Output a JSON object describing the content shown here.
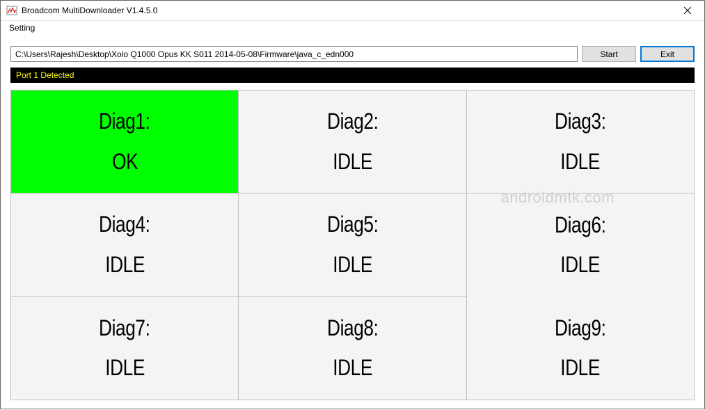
{
  "window": {
    "title": "Broadcom MultiDownloader V1.4.5.0"
  },
  "menu": {
    "setting": "Setting"
  },
  "toolbar": {
    "path_value": "C:\\Users\\Rajesh\\Desktop\\Xolo Q1000 Opus KK S011 2014-05-08\\Firmware\\java_c_edn000",
    "start_label": "Start",
    "exit_label": "Exit"
  },
  "status": {
    "text": "Port 1 Detected"
  },
  "diag": {
    "cells": [
      {
        "label": "Diag1:",
        "status": "OK",
        "ok": true
      },
      {
        "label": "Diag2:",
        "status": "IDLE",
        "ok": false
      },
      {
        "label": "Diag3:",
        "status": "IDLE",
        "ok": false
      },
      {
        "label": "Diag4:",
        "status": "IDLE",
        "ok": false
      },
      {
        "label": "Diag5:",
        "status": "IDLE",
        "ok": false
      },
      {
        "label": "Diag6:",
        "status": "IDLE",
        "ok": false
      },
      {
        "label": "Diag7:",
        "status": "IDLE",
        "ok": false
      },
      {
        "label": "Diag8:",
        "status": "IDLE",
        "ok": false
      },
      {
        "label": "Diag9:",
        "status": "IDLE",
        "ok": false
      }
    ]
  },
  "watermark": {
    "text": "androidmtk.com"
  }
}
